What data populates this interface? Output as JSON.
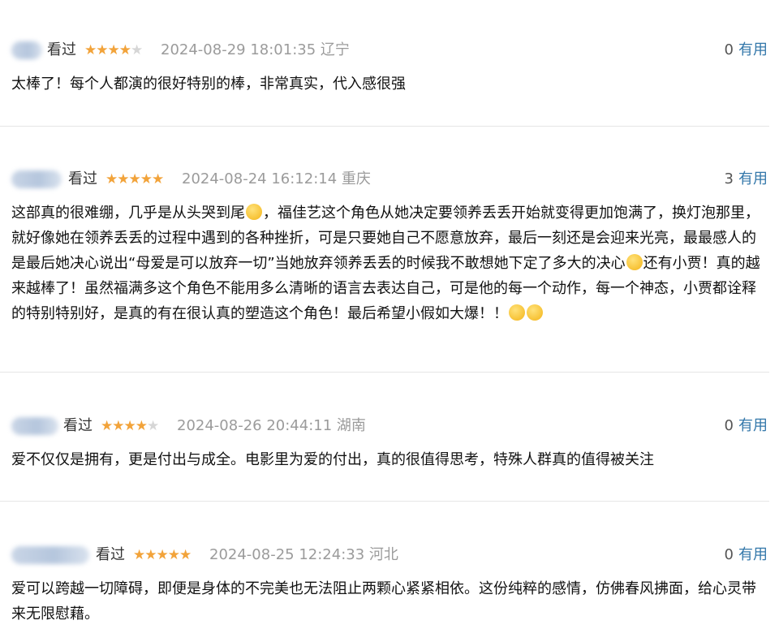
{
  "reviews": [
    {
      "watched_label": "看过",
      "rating": 4,
      "stars_on": "★★★★",
      "stars_off": "★",
      "time": "2024-08-29 18:01:35",
      "location": "辽宁",
      "useful_count": "0",
      "useful_label": "有用",
      "content": "太棒了！每个人都演的很好特别的棒，非常真实，代入感很强"
    },
    {
      "watched_label": "看过",
      "rating": 5,
      "stars_on": "★★★★★",
      "stars_off": "",
      "time": "2024-08-24 16:12:14",
      "location": "重庆",
      "useful_count": "3",
      "useful_label": "有用",
      "content_parts": [
        "这部真的很难绷，几乎是从头哭到尾",
        "，福佳艺这个角色从她决定要领养丢丢开始就变得更加饱满了，换灯泡那里，就好像她在领养丢丢的过程中遇到的各种挫折，可是只要她自己不愿意放弃，最后一刻还是会迎来光亮，最最感人的是最后她决心说出“母爱是可以放弃一切”当她放弃领养丢丢的时候我不敢想她下定了多大的决心",
        "还有小贾！真的越来越棒了！虽然福满多这个角色不能用多么清晰的语言去表达自己，可是他的每一个动作，每一个神态，小贾都诠释的特别特别好，是真的有在很认真的塑造这个角色！最后希望小假如大爆！！"
      ]
    },
    {
      "watched_label": "看过",
      "rating": 4,
      "stars_on": "★★★★",
      "stars_off": "★",
      "time": "2024-08-26 20:44:11",
      "location": "湖南",
      "useful_count": "0",
      "useful_label": "有用",
      "content": "爱不仅仅是拥有，更是付出与成全。电影里为爱的付出，真的很值得思考，特殊人群真的值得被关注"
    },
    {
      "watched_label": "看过",
      "rating": 5,
      "stars_on": "★★★★★",
      "stars_off": "",
      "time": "2024-08-25 12:24:33",
      "location": "河北",
      "useful_count": "0",
      "useful_label": "有用",
      "content": "爱可以跨越一切障碍，即便是身体的不完美也无法阻止两颗心紧紧相依。这份纯粹的感情，仿佛春风拂面，给心灵带来无限慰藉。"
    }
  ],
  "colors": {
    "star": "#f2a33a",
    "star_empty": "#d6d6d6",
    "meta": "#9b9b9b",
    "link": "#3377aa"
  }
}
